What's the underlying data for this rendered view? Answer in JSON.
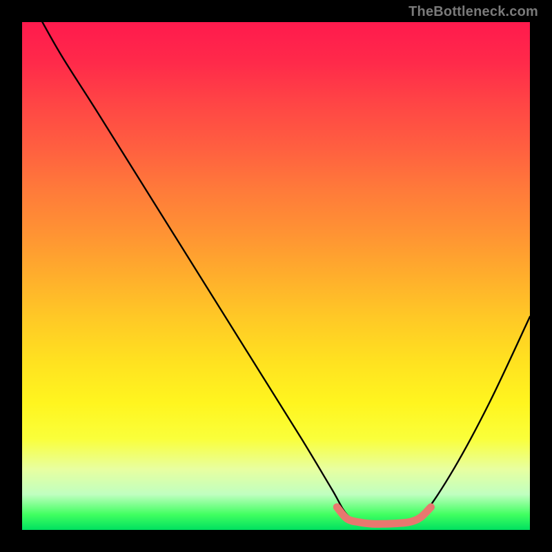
{
  "watermark": "TheBottleneck.com",
  "chart_data": {
    "type": "line",
    "title": "",
    "xlabel": "",
    "ylabel": "",
    "xlim": [
      0,
      100
    ],
    "ylim": [
      0,
      100
    ],
    "series": [
      {
        "name": "bottleneck-curve",
        "color": "#000000",
        "x": [
          4,
          8,
          15,
          25,
          35,
          45,
          55,
          61,
          64,
          67,
          70,
          73,
          76,
          79,
          85,
          92,
          100
        ],
        "y": [
          100,
          93,
          82,
          66,
          50,
          34,
          18,
          8,
          3,
          1.5,
          1.2,
          1.2,
          1.5,
          3,
          12,
          25,
          42
        ]
      },
      {
        "name": "optimal-band",
        "color": "#e8786f",
        "x": [
          62,
          64,
          66.5,
          69,
          71.5,
          74,
          76.5,
          78.5,
          80.5
        ],
        "y": [
          4.5,
          2.2,
          1.5,
          1.2,
          1.2,
          1.3,
          1.6,
          2.5,
          4.5
        ]
      }
    ],
    "gradient_stops": [
      {
        "pct": 0,
        "color": "#ff1a4d"
      },
      {
        "pct": 50,
        "color": "#ffae2c"
      },
      {
        "pct": 80,
        "color": "#fff51f"
      },
      {
        "pct": 100,
        "color": "#00e060"
      }
    ]
  }
}
